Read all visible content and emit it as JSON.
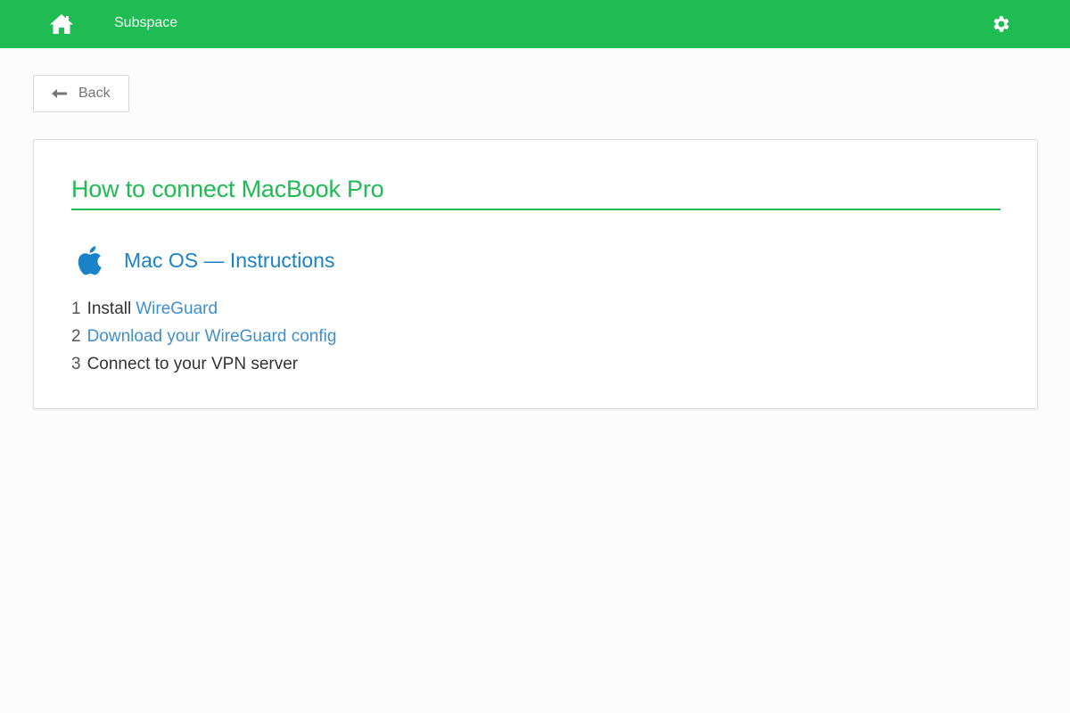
{
  "header": {
    "brand": "Subspace",
    "home_icon": "home-icon",
    "settings_icon": "gear-icon",
    "color": "#1fbb53"
  },
  "back": {
    "label": "Back",
    "icon": "arrow-left-icon"
  },
  "card": {
    "title": "How to connect MacBook Pro",
    "os": {
      "icon": "apple-icon",
      "title": "Mac OS — Instructions",
      "color": "#1a82c8"
    },
    "steps": [
      {
        "num": "1",
        "text": "Install",
        "link": "WireGuard"
      },
      {
        "num": "2",
        "link": "Download your WireGuard config"
      },
      {
        "num": "3",
        "text": "Connect to your VPN server"
      }
    ]
  }
}
